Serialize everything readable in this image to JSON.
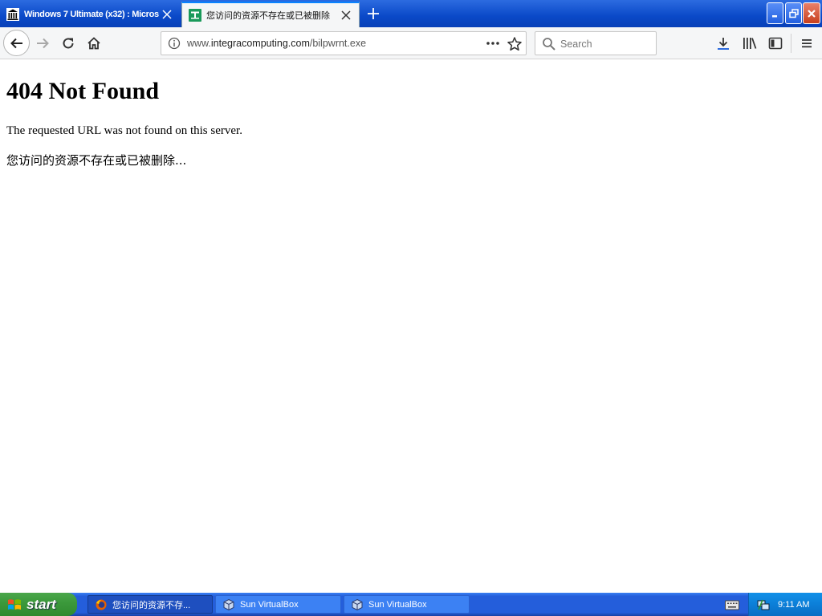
{
  "browser": {
    "tabs": [
      {
        "label": "Windows 7 Ultimate (x32) : Micros",
        "favicon": "museum-icon",
        "active": false
      },
      {
        "label": "您访问的资源不存在或已被删除",
        "favicon": "green-t-icon",
        "active": true
      }
    ],
    "new_tab_icon": "plus-icon"
  },
  "navbar": {
    "url_prefix": "www.",
    "url_domain": "integracomputing.com",
    "url_path": "/bilpwrnt.exe",
    "search_placeholder": "Search"
  },
  "page": {
    "heading": "404 Not Found",
    "message": "The requested URL was not found on this server.",
    "message_cn": "您访问的资源不存在或已被删除..."
  },
  "taskbar": {
    "start_label": "start",
    "tasks": [
      {
        "label": "您访问的资源不存...",
        "active": true
      },
      {
        "label": "Sun VirtualBox",
        "active": false
      },
      {
        "label": "Sun VirtualBox",
        "active": false
      }
    ],
    "clock": "9:11 AM"
  },
  "colors": {
    "title_bar_blue": "#0a49c8",
    "active_tab_accent": "#0a84ff",
    "favicon_green": "#1a9a5a",
    "start_green": "#3c9a3c",
    "taskbar_blue": "#245edb",
    "tray_blue": "#0c7fd8"
  }
}
